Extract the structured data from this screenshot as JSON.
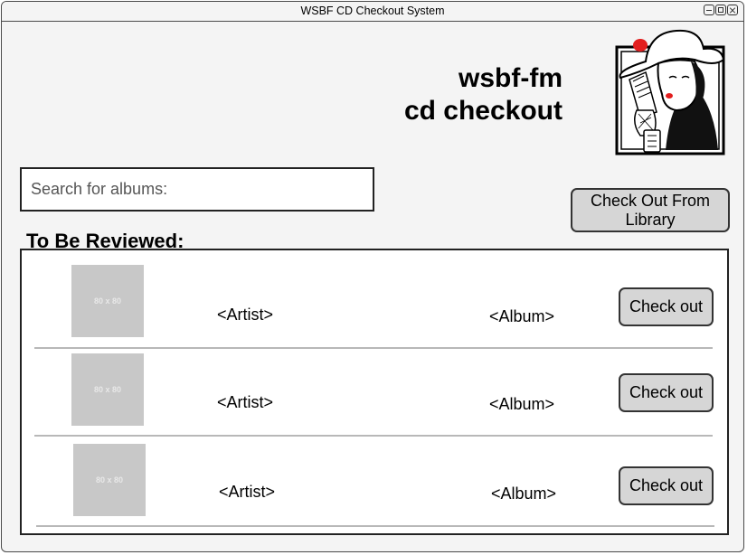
{
  "window": {
    "title": "WSBF CD Checkout System"
  },
  "header": {
    "line1": "wsbf-fm",
    "line2": "cd checkout"
  },
  "search": {
    "placeholder": "Search for albums:"
  },
  "library_button": "Check Out From Library",
  "section_title": "To Be Reviewed:",
  "items": [
    {
      "thumb_label": "80 x 80",
      "artist": "<Artist>",
      "album": "<Album>",
      "button": "Check out"
    },
    {
      "thumb_label": "80 x 80",
      "artist": "<Artist>",
      "album": "<Album>",
      "button": "Check out"
    },
    {
      "thumb_label": "80 x 80",
      "artist": "<Artist>",
      "album": "<Album>",
      "button": "Check out"
    }
  ],
  "colors": {
    "button_bg": "#d6d6d6",
    "placeholder_thumb": "#c8c8c8",
    "logo_accent": "#e21e1e"
  }
}
